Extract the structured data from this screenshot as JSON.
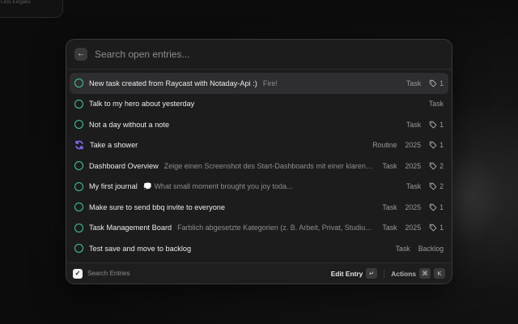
{
  "background": {
    "widget_text": "Leos Eingabe"
  },
  "search": {
    "placeholder": "Search open entries..."
  },
  "entries": [
    {
      "title": "New task created from Raycast with Notaday-Api :)",
      "subtitle": "Fire!",
      "type": "Task",
      "year": "",
      "tag_count": "1",
      "icon": "circle-icon",
      "selected": true
    },
    {
      "title": "Talk to my hero about yesterday",
      "subtitle": "",
      "type": "Task",
      "year": "",
      "tag_count": "",
      "icon": "circle-icon"
    },
    {
      "title": "Not a day without a note",
      "subtitle": "",
      "type": "Task",
      "year": "",
      "tag_count": "1",
      "icon": "circle-icon"
    },
    {
      "title": "Take a shower",
      "subtitle": "",
      "type": "Routine",
      "year": "2025",
      "tag_count": "1",
      "icon": "sync-icon"
    },
    {
      "title": "Dashboard Overview",
      "subtitle": "Zeige einen Screenshot des Start-Dashboards mit einer klaren Ü...",
      "type": "Task",
      "year": "2025",
      "tag_count": "2",
      "icon": "circle-icon"
    },
    {
      "title": "My first journal",
      "subtitle": "💭 What small moment brought you joy toda...",
      "type": "Task",
      "year": "",
      "tag_count": "2",
      "icon": "circle-icon"
    },
    {
      "title": "Make sure to send bbq invite to everyone",
      "subtitle": "",
      "type": "Task",
      "year": "2025",
      "tag_count": "1",
      "icon": "circle-icon"
    },
    {
      "title": "Task Management Board",
      "subtitle": "Farblich abgesetzte Kategorien (z. B. Arbeit, Privat, Studiu...",
      "type": "Task",
      "year": "2025",
      "tag_count": "1",
      "icon": "circle-icon"
    },
    {
      "title": "Test save and move to backlog",
      "subtitle": "",
      "type": "Task",
      "year": "Backlog",
      "tag_count": "",
      "icon": "circle-icon"
    }
  ],
  "footer": {
    "label": "Search Entries",
    "primary_action": "Edit Entry",
    "primary_key": "↵",
    "secondary_action": "Actions",
    "secondary_keys": [
      "⌘",
      "K"
    ]
  },
  "colors": {
    "accent_green": "#3ec99a",
    "accent_purple": "#8b6cf6",
    "panel_bg": "#1c1c1d",
    "selected_bg": "#2e2e30"
  }
}
